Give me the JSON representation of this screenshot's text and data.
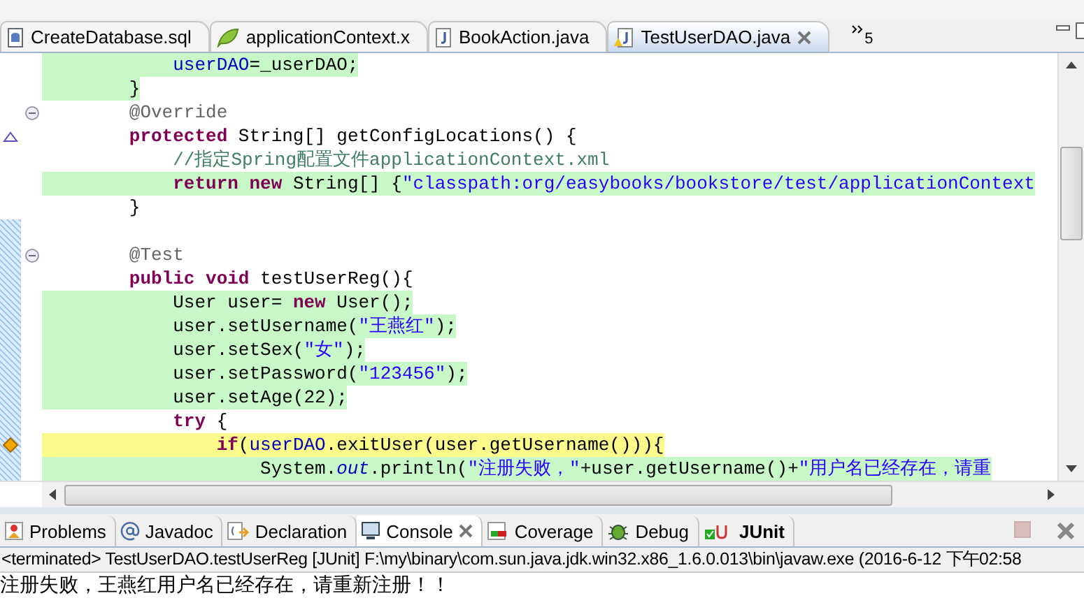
{
  "editor_tabs": [
    {
      "label": "CreateDatabase.sql",
      "kind": "sql",
      "selected": false
    },
    {
      "label": "applicationContext.x",
      "kind": "spring",
      "selected": false
    },
    {
      "label": "BookAction.java",
      "kind": "java",
      "selected": false
    },
    {
      "label": "TestUserDAO.java",
      "kind": "java-warning",
      "selected": true
    }
  ],
  "overflow_count": "5",
  "editor": {
    "lines": [
      {
        "kind": "hidden",
        "children": [
          {
            "kind": "covered",
            "changed": false,
            "fold": false,
            "overrides": false,
            "warning": false,
            "segments": [
              {
                "t": "userDAO",
                "kind": "field"
              },
              {
                "t": "=_userDAO;",
                "kind": "plain"
              }
            ]
          }
        ]
      },
      {
        "kind": "covered",
        "changed": false,
        "fold": false,
        "overrides": false,
        "warning": false,
        "segments": [
          {
            "t": "}",
            "kind": "plain"
          }
        ]
      },
      {
        "kind": "plain",
        "changed": false,
        "fold": true,
        "overrides": false,
        "warning": false,
        "segments": [
          {
            "t": "@Override",
            "kind": "ann"
          }
        ]
      },
      {
        "kind": "plain",
        "changed": false,
        "fold": false,
        "overrides": true,
        "warning": false,
        "segments": [
          {
            "t": "protected",
            "kind": "kw"
          },
          {
            "t": " String[] getConfigLocations() {",
            "kind": "plain"
          }
        ],
        "children": [
          {
            "kind": "plain",
            "changed": false,
            "fold": false,
            "overrides": false,
            "warning": false,
            "segments": [
              {
                "t": "//指定Spring配置文件applicationContext.xml",
                "kind": "comment"
              }
            ]
          },
          {
            "kind": "covered",
            "changed": false,
            "fold": false,
            "overrides": false,
            "warning": false,
            "segments": [
              {
                "t": "return",
                "kind": "kw"
              },
              {
                "t": " new",
                "kind": "kw"
              },
              {
                "t": " String[] {",
                "kind": "plain"
              },
              {
                "t": "\"classpath:org/easybooks/bookstore/test/applicationContext",
                "kind": "str"
              }
            ]
          }
        ]
      },
      {
        "kind": "plain",
        "changed": false,
        "fold": false,
        "overrides": false,
        "warning": false,
        "segments": [
          {
            "t": "}",
            "kind": "plain"
          }
        ]
      },
      {
        "kind": "blank",
        "changed": true,
        "fold": false,
        "overrides": false,
        "warning": false
      },
      {
        "kind": "plain",
        "changed": true,
        "fold": true,
        "overrides": false,
        "warning": false,
        "segments": [
          {
            "t": "@Test",
            "kind": "ann"
          }
        ]
      },
      {
        "kind": "plain",
        "changed": true,
        "fold": false,
        "overrides": false,
        "warning": false,
        "segments": [
          {
            "t": "public",
            "kind": "kw"
          },
          {
            "t": " void",
            "kind": "kw"
          },
          {
            "t": " testUserReg(){",
            "kind": "plain"
          }
        ],
        "children": [
          {
            "kind": "covered",
            "changed": true,
            "fold": false,
            "overrides": false,
            "warning": false,
            "segments": [
              {
                "t": "User user= ",
                "kind": "plain"
              },
              {
                "t": "new",
                "kind": "kw"
              },
              {
                "t": " User();",
                "kind": "plain"
              }
            ]
          },
          {
            "kind": "covered",
            "changed": true,
            "fold": false,
            "overrides": false,
            "warning": false,
            "segments": [
              {
                "t": "user.setUsername(",
                "kind": "plain"
              },
              {
                "t": "\"王燕红\"",
                "kind": "str"
              },
              {
                "t": ");",
                "kind": "plain"
              }
            ]
          },
          {
            "kind": "covered",
            "changed": true,
            "fold": false,
            "overrides": false,
            "warning": false,
            "segments": [
              {
                "t": "user.setSex(",
                "kind": "plain"
              },
              {
                "t": "\"女\"",
                "kind": "str"
              },
              {
                "t": ");",
                "kind": "plain"
              }
            ]
          },
          {
            "kind": "covered",
            "changed": true,
            "fold": false,
            "overrides": false,
            "warning": false,
            "segments": [
              {
                "t": "user.setPassword(",
                "kind": "plain"
              },
              {
                "t": "\"123456\"",
                "kind": "str"
              },
              {
                "t": ");",
                "kind": "plain"
              }
            ]
          },
          {
            "kind": "covered",
            "changed": true,
            "fold": false,
            "overrides": false,
            "warning": false,
            "segments": [
              {
                "t": "user.setAge(22);",
                "kind": "plain"
              }
            ]
          },
          {
            "kind": "plain",
            "changed": true,
            "fold": false,
            "overrides": false,
            "warning": false,
            "segments": [
              {
                "t": "try",
                "kind": "kw"
              },
              {
                "t": " {",
                "kind": "plain"
              }
            ],
            "children": [
              {
                "kind": "partial",
                "changed": true,
                "fold": false,
                "overrides": false,
                "warning": true,
                "segments": [
                  {
                    "t": "if",
                    "kind": "kw"
                  },
                  {
                    "t": "(",
                    "kind": "plain"
                  },
                  {
                    "t": "userDAO",
                    "kind": "field"
                  },
                  {
                    "t": ".exitUser(user.getUsername())){",
                    "kind": "plain"
                  }
                ],
                "children": [
                  {
                    "kind": "covered",
                    "changed": true,
                    "fold": false,
                    "overrides": false,
                    "warning": false,
                    "segments": [
                      {
                        "t": "System.",
                        "kind": "plain"
                      },
                      {
                        "t": "out",
                        "kind": "static"
                      },
                      {
                        "t": ".println(",
                        "kind": "plain"
                      },
                      {
                        "t": "\"注册失败，\"",
                        "kind": "str"
                      },
                      {
                        "t": "+user.getUsername()+",
                        "kind": "plain"
                      },
                      {
                        "t": "\"用户名已经存在，请重",
                        "kind": "str"
                      }
                    ]
                  }
                ]
              }
            ]
          }
        ]
      }
    ]
  },
  "view_tabs": [
    {
      "label": "Problems",
      "kind": "problems",
      "selected": false,
      "bold": false
    },
    {
      "label": "Javadoc",
      "kind": "javadoc",
      "selected": false,
      "bold": false
    },
    {
      "label": "Declaration",
      "kind": "declaration",
      "selected": false,
      "bold": false
    },
    {
      "label": "Console",
      "kind": "console",
      "selected": true,
      "bold": false
    },
    {
      "label": "Coverage",
      "kind": "coverage",
      "selected": false,
      "bold": false
    },
    {
      "label": "Debug",
      "kind": "debug",
      "selected": false,
      "bold": false
    },
    {
      "label": "JUnit",
      "kind": "junit",
      "selected": false,
      "bold": true
    }
  ],
  "console_actions": [
    {
      "kind": "terminate",
      "disabled": true
    },
    {
      "kind": "remove",
      "disabled": false
    }
  ],
  "console": {
    "status": "<terminated> TestUserDAO.testUserReg [JUnit] F:\\my\\binary\\com.sun.java.jdk.win32.x86_1.6.0.013\\bin\\javaw.exe (2016-6-12 下午02:58",
    "output": "注册失败，王燕红用户名已经存在，请重新注册！！"
  }
}
